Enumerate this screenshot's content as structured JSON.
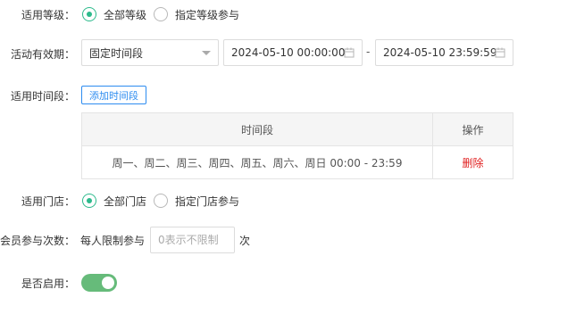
{
  "level": {
    "label": "适用等级：",
    "options": [
      {
        "label": "全部等级",
        "selected": true
      },
      {
        "label": "指定等级参与",
        "selected": false
      }
    ]
  },
  "validity": {
    "label": "活动有效期：",
    "mode": "固定时间段",
    "start": "2024-05-10 00:00:00",
    "separator": "-",
    "end": "2024-05-10 23:59:59"
  },
  "timeslot": {
    "label": "适用时间段：",
    "add_button": "添加时间段",
    "columns": [
      "时间段",
      "操作"
    ],
    "rows": [
      {
        "period": "周一、周二、周三、周四、周五、周六、周日 00:00 - 23:59",
        "action": "删除"
      }
    ]
  },
  "store": {
    "label": "适用门店：",
    "options": [
      {
        "label": "全部门店",
        "selected": true
      },
      {
        "label": "指定门店参与",
        "selected": false
      }
    ]
  },
  "count": {
    "label": "会员参与次数：",
    "prefix": "每人限制参与",
    "placeholder": "0表示不限制",
    "suffix": "次"
  },
  "enabled": {
    "label": "是否启用：",
    "value": true
  },
  "colors": {
    "accent": "#2dba8c",
    "link": "#2d8cf0",
    "danger": "#e02020",
    "toggle_on": "#66bb7a"
  }
}
